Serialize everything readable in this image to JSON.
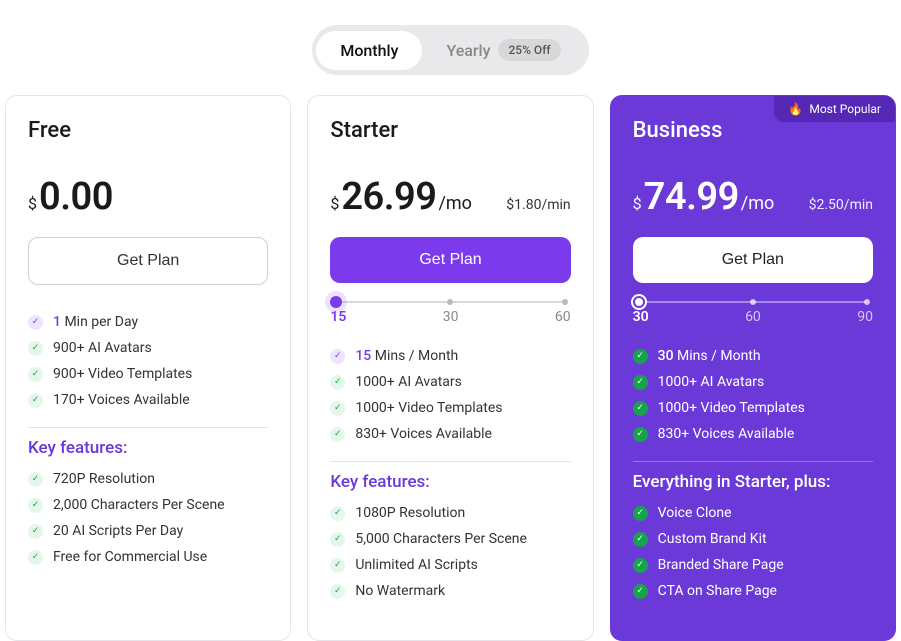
{
  "toggle": {
    "monthly": "Monthly",
    "yearly": "Yearly",
    "discount": "25% Off"
  },
  "plans": {
    "free": {
      "name": "Free",
      "currency": "$",
      "amount": "0.00",
      "per": "",
      "perMin": "",
      "cta": "Get Plan",
      "core": [
        {
          "check": "c1",
          "hl": "1",
          "rest": " Min per Day"
        },
        {
          "check": "c2",
          "rest": "900+ AI Avatars"
        },
        {
          "check": "c2",
          "rest": "900+ Video Templates"
        },
        {
          "check": "c2",
          "rest": "170+ Voices Available"
        }
      ],
      "keyTitle": "Key features:",
      "keys": [
        "720P Resolution",
        "2,000 Characters Per Scene",
        "20 AI Scripts Per Day",
        "Free for Commercial Use"
      ]
    },
    "starter": {
      "name": "Starter",
      "currency": "$",
      "amount": "26.99",
      "per": "/mo",
      "perMin": "$1.80/min",
      "cta": "Get Plan",
      "slider": {
        "a": "15",
        "b": "30",
        "c": "60"
      },
      "core": [
        {
          "check": "c1",
          "hl": "15",
          "rest": " Mins / Month"
        },
        {
          "check": "c2",
          "rest": "1000+ AI Avatars"
        },
        {
          "check": "c2",
          "rest": "1000+ Video Templates"
        },
        {
          "check": "c2",
          "rest": "830+ Voices Available"
        }
      ],
      "keyTitle": "Key features:",
      "keys": [
        "1080P Resolution",
        "5,000 Characters Per Scene",
        "Unlimited AI Scripts",
        "No Watermark"
      ]
    },
    "business": {
      "badge": "Most Popular",
      "name": "Business",
      "currency": "$",
      "amount": "74.99",
      "per": "/mo",
      "perMin": "$2.50/min",
      "cta": "Get Plan",
      "slider": {
        "a": "30",
        "b": "60",
        "c": "90"
      },
      "core": [
        {
          "check": "c3",
          "hl": "30",
          "rest": " Mins / Month"
        },
        {
          "check": "c3",
          "rest": "1000+ AI Avatars"
        },
        {
          "check": "c3",
          "rest": "1000+ Video Templates"
        },
        {
          "check": "c3",
          "rest": "830+ Voices Available"
        }
      ],
      "keyTitle": "Everything in Starter, plus:",
      "keys": [
        "Voice Clone",
        "Custom Brand Kit",
        "Branded Share Page",
        "CTA on Share Page"
      ]
    }
  }
}
